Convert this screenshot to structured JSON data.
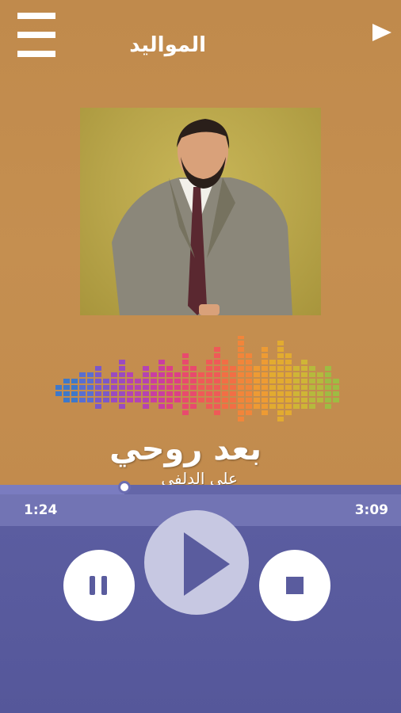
{
  "header": {
    "title": "المواليد",
    "menu_icon": "hamburger-menu-icon",
    "play_icon": "play-icon"
  },
  "song": {
    "title": "بعد روحي",
    "artist": "علي الدلفي"
  },
  "playback": {
    "elapsed": "1:24",
    "duration": "3:09",
    "progress_fraction": 0.31
  },
  "controls": {
    "pause_icon": "pause-icon",
    "play_icon": "play-icon",
    "stop_icon": "stop-icon"
  },
  "colors": {
    "player_bg": "#5c5ea1",
    "time_bar": "#7274b4",
    "background": "#c08a4c"
  }
}
